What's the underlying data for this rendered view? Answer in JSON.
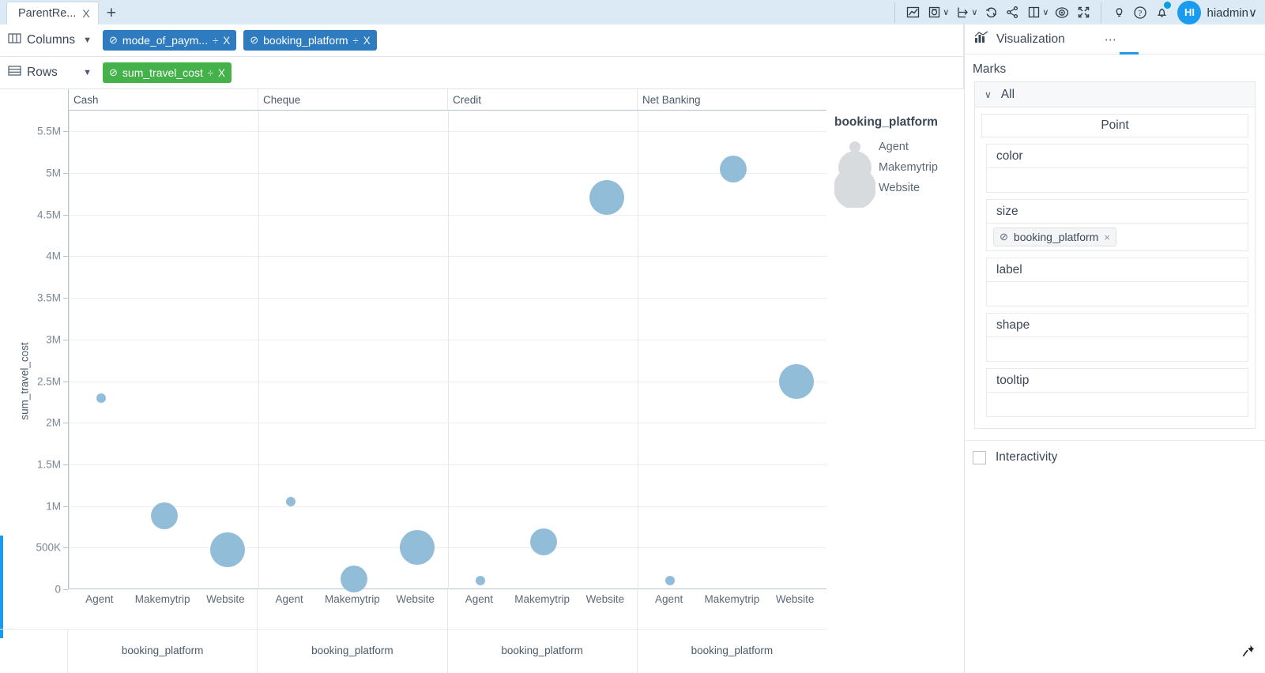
{
  "window": {
    "tab": {
      "label": "ParentRe...",
      "close_label": "X"
    },
    "add_tab_label": "+",
    "toolbar": [
      {
        "name": "chart-icon",
        "label": "Chart"
      },
      {
        "name": "data-source-icon",
        "label": "Data Source"
      },
      {
        "name": "export-icon",
        "label": "Export"
      },
      {
        "name": "refresh-icon",
        "label": "Refresh"
      },
      {
        "name": "share-icon",
        "label": "Share"
      },
      {
        "name": "layout-icon",
        "label": "Layout"
      },
      {
        "name": "preview-icon",
        "label": "Preview"
      },
      {
        "name": "fullscreen-icon",
        "label": "Fullscreen"
      },
      {
        "name": "lightbulb-icon",
        "label": "Insights"
      },
      {
        "name": "help-icon",
        "label": "Help"
      },
      {
        "name": "notifications-icon",
        "label": "Notifications"
      }
    ],
    "user": {
      "initials": "HI",
      "name": "hiadmin",
      "caret": "∨"
    }
  },
  "shelves": {
    "columns": {
      "label": "Columns",
      "icon": "columns-icon",
      "caret": "▼",
      "chips": [
        {
          "check": "⊘",
          "label": "mode_of_paym...",
          "divide": "÷",
          "close": "X",
          "color": "#2e7cbf"
        },
        {
          "check": "⊘",
          "label": "booking_platform",
          "divide": "÷",
          "close": "X",
          "color": "#2e7cbf"
        }
      ]
    },
    "rows": {
      "label": "Rows",
      "icon": "rows-icon",
      "caret": "▼",
      "chips": [
        {
          "check": "⊘",
          "label": "sum_travel_cost",
          "divide": "÷",
          "close": "X",
          "color": "#44b14b"
        }
      ]
    }
  },
  "chart_data": {
    "type": "scatter",
    "title": "",
    "xlabel": "booking_platform",
    "ylabel": "sum_travel_cost",
    "ylim": [
      0,
      5750000
    ],
    "yticks": [
      "0",
      "500K",
      "1M",
      "1.5M",
      "2M",
      "2.5M",
      "3M",
      "3.5M",
      "4M",
      "4.5M",
      "5M",
      "5.5M"
    ],
    "ytick_values": [
      0,
      500000,
      1000000,
      1500000,
      2000000,
      2500000,
      3000000,
      3500000,
      4000000,
      4500000,
      5000000,
      5500000
    ],
    "grid": true,
    "legend": {
      "title": "booking_platform",
      "position": "right",
      "encodes": "size",
      "entries": [
        {
          "label": "Agent",
          "radius_px": 7
        },
        {
          "label": "Makemytrip",
          "radius_px": 21
        },
        {
          "label": "Website",
          "radius_px": 27
        }
      ]
    },
    "panel_field": "mode_of_payment",
    "categories": [
      "Agent",
      "Makemytrip",
      "Website"
    ],
    "panels": [
      {
        "label": "Cash",
        "points": [
          {
            "x": "Agent",
            "y": 2300000,
            "r": 6
          },
          {
            "x": "Makemytrip",
            "y": 880000,
            "r": 17
          },
          {
            "x": "Website",
            "y": 470000,
            "r": 22
          }
        ]
      },
      {
        "label": "Cheque",
        "points": [
          {
            "x": "Agent",
            "y": 1050000,
            "r": 6
          },
          {
            "x": "Makemytrip",
            "y": 120000,
            "r": 17
          },
          {
            "x": "Website",
            "y": 500000,
            "r": 22
          }
        ]
      },
      {
        "label": "Credit",
        "points": [
          {
            "x": "Agent",
            "y": 105000,
            "r": 6
          },
          {
            "x": "Makemytrip",
            "y": 565000,
            "r": 17
          },
          {
            "x": "Website",
            "y": 4710000,
            "r": 22
          }
        ]
      },
      {
        "label": "Net Banking",
        "points": [
          {
            "x": "Agent",
            "y": 105000,
            "r": 6
          },
          {
            "x": "Makemytrip",
            "y": 5045000,
            "r": 17
          },
          {
            "x": "Website",
            "y": 2500000,
            "r": 22
          }
        ]
      }
    ],
    "mark_color": "#92bdd9"
  },
  "right_panel": {
    "header": {
      "title": "Visualization",
      "icon": "visualization-icon",
      "dots": "⋯"
    },
    "marks_label": "Marks",
    "marks_all": {
      "label": "All",
      "chevron": "∨"
    },
    "mark_type": "Point",
    "encodings": [
      {
        "name": "color",
        "label": "color",
        "pills": []
      },
      {
        "name": "size",
        "label": "size",
        "pills": [
          {
            "check": "⊘",
            "label": "booking_platform",
            "close": "×"
          }
        ]
      },
      {
        "name": "label",
        "label": "label",
        "pills": []
      },
      {
        "name": "shape",
        "label": "shape",
        "pills": []
      },
      {
        "name": "tooltip",
        "label": "tooltip",
        "pills": []
      }
    ],
    "interactivity": {
      "label": "Interactivity",
      "checked": false
    },
    "pin_icon": "pushpin-icon"
  },
  "canvas_footer": {
    "pin_icon": "pushpin-icon",
    "hourglass_icon": "hourglass-icon"
  },
  "colors": {
    "accent": "#1b9bf0",
    "chip_blue": "#2e7cbf",
    "chip_green": "#44b14b",
    "mark": "#92bdd9",
    "topbar_bg": "#dceaf5"
  }
}
